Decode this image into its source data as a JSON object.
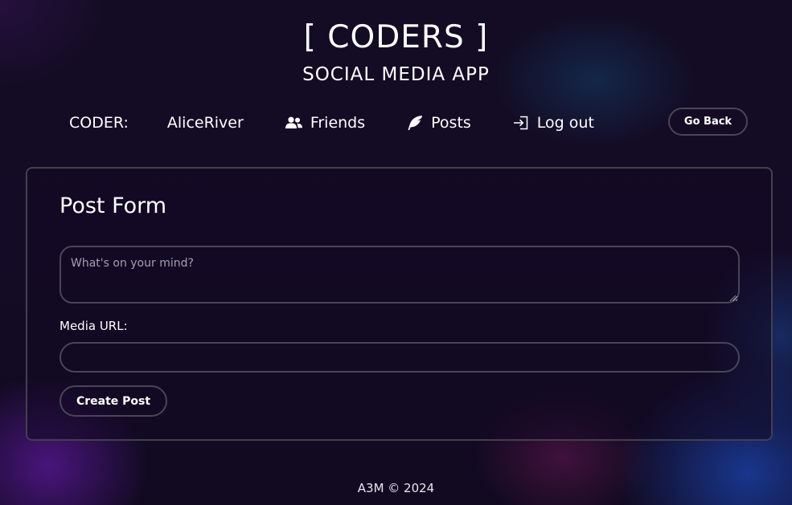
{
  "header": {
    "title": "[ CODERS ]",
    "subtitle": "SOCIAL MEDIA APP"
  },
  "nav": {
    "coder_label": "CODER:",
    "username": "AliceRiver",
    "links": [
      {
        "label": "Friends",
        "icon": "users-icon"
      },
      {
        "label": "Posts",
        "icon": "feather-icon"
      },
      {
        "label": "Log out",
        "icon": "log-in-icon"
      }
    ],
    "go_back_label": "Go Back"
  },
  "post_form": {
    "title": "Post Form",
    "content_placeholder": "What's on your mind?",
    "content_value": "",
    "media_label": "Media URL:",
    "media_value": "",
    "submit_label": "Create Post"
  },
  "footer": {
    "text": "A3M © 2024"
  }
}
